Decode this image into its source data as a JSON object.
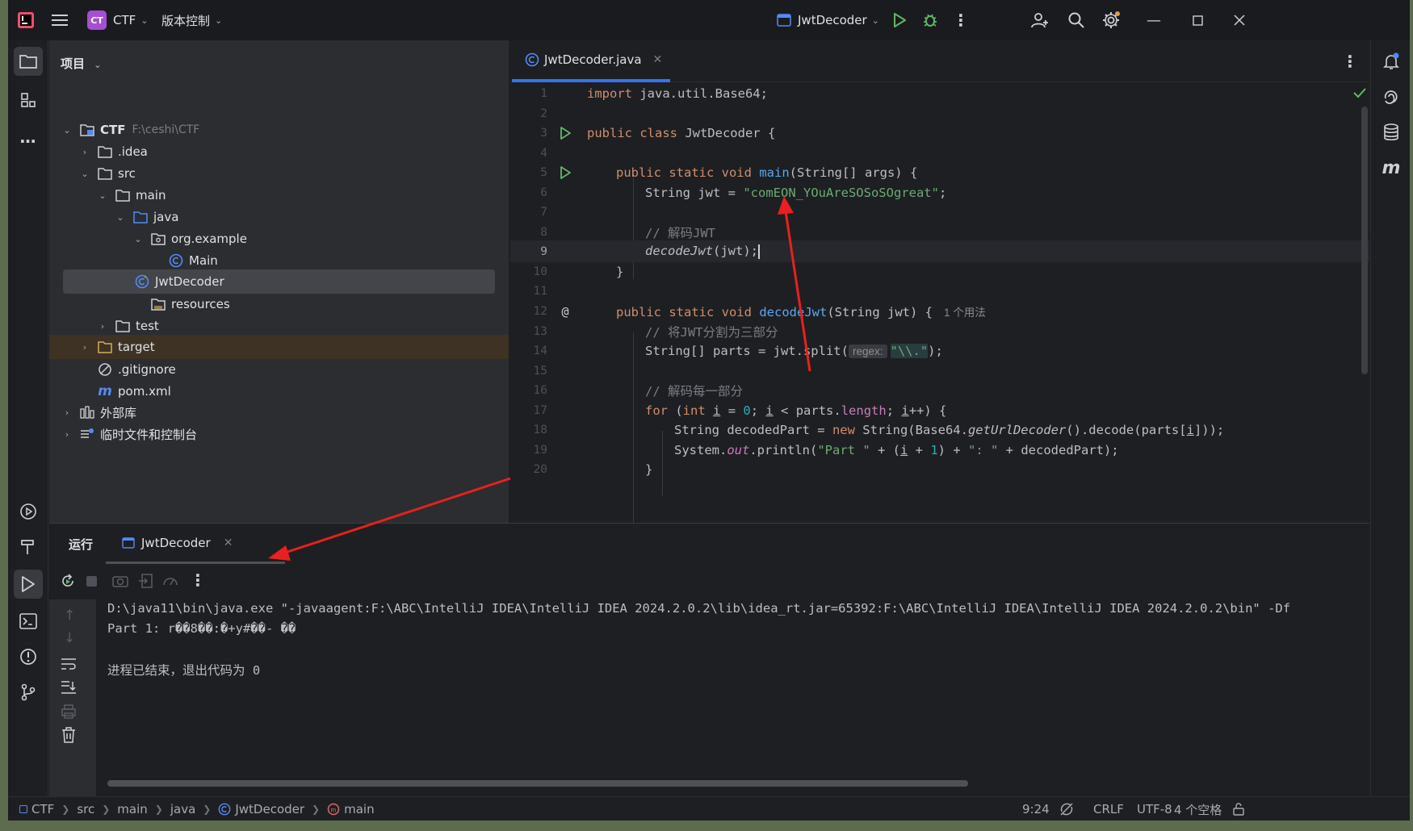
{
  "titlebar": {
    "project_badge": "CT",
    "project_name": "CTF",
    "vcs_label": "版本控制",
    "run_config": "JwtDecoder"
  },
  "project_panel": {
    "header": "项目",
    "tree": [
      {
        "label": "CTF",
        "path": "F:\\ceshi\\CTF",
        "icon": "folder-icon"
      },
      {
        "label": ".idea",
        "icon": "folder-icon"
      },
      {
        "label": "src",
        "icon": "folder-icon"
      },
      {
        "label": "main",
        "icon": "folder-icon"
      },
      {
        "label": "java",
        "icon": "source-folder-icon"
      },
      {
        "label": "org.example",
        "icon": "package-icon"
      },
      {
        "label": "Main",
        "icon": "class-icon"
      },
      {
        "label": "JwtDecoder",
        "icon": "class-icon"
      },
      {
        "label": "resources",
        "icon": "resources-folder-icon"
      },
      {
        "label": "test",
        "icon": "folder-icon"
      },
      {
        "label": "target",
        "icon": "excluded-folder-icon"
      },
      {
        "label": ".gitignore",
        "icon": "ignore-file-icon"
      },
      {
        "label": "pom.xml",
        "icon": "maven-icon"
      },
      {
        "label": "外部库",
        "icon": "library-icon"
      },
      {
        "label": "临时文件和控制台",
        "icon": "scratch-icon"
      }
    ]
  },
  "editor": {
    "tab_label": "JwtDecoder.java",
    "line_numbers": [
      "1",
      "2",
      "3",
      "4",
      "5",
      "6",
      "7",
      "8",
      "9",
      "10",
      "11",
      "12",
      "13",
      "14",
      "15",
      "16",
      "17",
      "18",
      "19",
      "20"
    ],
    "code": {
      "l1_kw": "import",
      "l1_rest": " java.util.Base64;",
      "l3_kw": "public class",
      "l3_rest": " JwtDecoder {",
      "l5_kw": "public static void",
      "l5_fn": "main",
      "l5_rest": "(String[] args) {",
      "l6_a": "String jwt = ",
      "l6_str": "\"comEON_YOuAreSOSoSOgreat\"",
      "l6_b": ";",
      "l8_cm": "// 解码JWT",
      "l9_fn": "decodeJwt",
      "l9_rest": "(jwt);",
      "l10": "}",
      "l12_kw": "public static void",
      "l12_fn": "decodeJwt",
      "l12_rest": "(String jwt) {",
      "l12_hint": "1 个用法",
      "l13_cm": "// 将JWT分割为三部分",
      "l14_a": "String[] parts = jwt.split(",
      "l14_inlay": "regex:",
      "l14_str": "\"\\\\.\"",
      "l14_b": ");",
      "l16_cm": "// 解码每一部分",
      "l17_kw1": "for",
      "l17_a": " (",
      "l17_kw2": "int",
      "l17_i1": "i",
      "l17_b": " = ",
      "l17_n0": "0",
      "l17_c": "; ",
      "l17_i2": "i",
      "l17_d": " < parts.",
      "l17_len": "length",
      "l17_e": "; ",
      "l17_i3": "i",
      "l17_f": "++) {",
      "l18_a": "String decodedPart = ",
      "l18_kw": "new",
      "l18_b": " String(Base64.",
      "l18_m": "getUrlDecoder",
      "l18_c": "().decode(parts[",
      "l18_i": "i",
      "l18_d": "]));",
      "l19_a": "System.",
      "l19_out": "out",
      "l19_b": ".println(",
      "l19_s1": "\"Part \"",
      "l19_c": " + (",
      "l19_i": "i",
      "l19_d": " + ",
      "l19_n": "1",
      "l19_e": ") + ",
      "l19_s2": "\": \"",
      "l19_f": " + decodedPart);",
      "l20": "}"
    }
  },
  "run_panel": {
    "title": "运行",
    "tab_label": "JwtDecoder",
    "console": [
      "D:\\java11\\bin\\java.exe \"-javaagent:F:\\ABC\\IntelliJ IDEA\\IntelliJ IDEA 2024.2.0.2\\lib\\idea_rt.jar=65392:F:\\ABC\\IntelliJ IDEA\\IntelliJ IDEA 2024.2.0.2\\bin\" -Df",
      "Part 1: r��8��:�+y#��- ��",
      "",
      "进程已结束，退出代码为 0"
    ]
  },
  "statusbar": {
    "breadcrumbs": [
      "CTF",
      "src",
      "main",
      "java",
      "JwtDecoder",
      "main"
    ],
    "position": "9:24",
    "line_ending": "CRLF",
    "encoding": "UTF-8",
    "indent": "4 个空格"
  },
  "colors": {
    "accent": "#3574f0",
    "annotation_arrow": "#e8201f",
    "run_green": "#5fb865",
    "project_badge": "#a54fd2"
  }
}
